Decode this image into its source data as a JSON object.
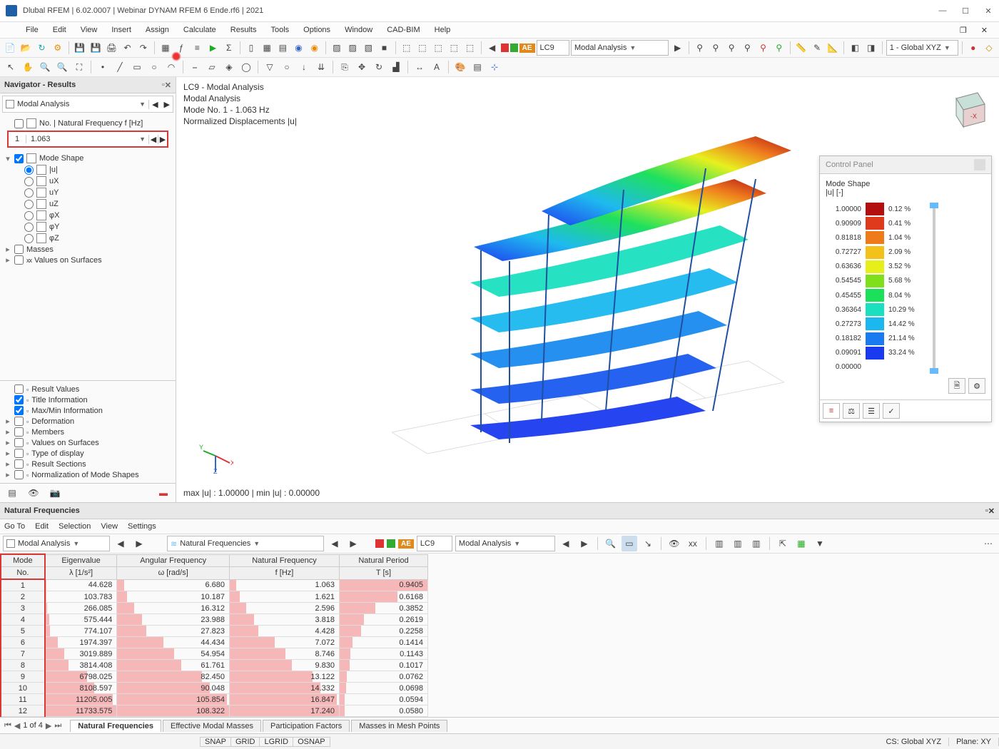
{
  "title": "Dlubal RFEM | 6.02.0007 | Webinar DYNAM RFEM 6 Ende.rf6 | 2021",
  "menus": [
    "File",
    "Edit",
    "View",
    "Insert",
    "Assign",
    "Calculate",
    "Results",
    "Tools",
    "Options",
    "Window",
    "CAD-BIM",
    "Help"
  ],
  "toolbar1": {
    "lc_label": "LC9",
    "lc_name": "Modal Analysis",
    "coord": "1 - Global XYZ"
  },
  "navigator": {
    "title": "Navigator - Results",
    "analysis": "Modal Analysis",
    "freq_header": "No. | Natural Frequency f [Hz]",
    "sel_no": "1",
    "sel_val": "1.063",
    "mode_shape": "Mode Shape",
    "components": [
      "|u|",
      "uX",
      "uY",
      "uZ",
      "φX",
      "φY",
      "φZ"
    ],
    "masses": "Masses",
    "vos": "Values on Surfaces",
    "opts": [
      "Result Values",
      "Title Information",
      "Max/Min Information",
      "Deformation",
      "Members",
      "Values on Surfaces",
      "Type of display",
      "Result Sections",
      "Normalization of Mode Shapes"
    ]
  },
  "viewport": {
    "l1": "LC9 - Modal Analysis",
    "l2": "Modal Analysis",
    "l3": "Mode No. 1 - 1.063 Hz",
    "l4": "Normalized Displacements |u|",
    "minmax": "max |u| : 1.00000 | min |u| : 0.00000"
  },
  "panel": {
    "title": "Control Panel",
    "sub1": "Mode Shape",
    "sub2": "|u| [-]",
    "legend": [
      {
        "v": "1.00000",
        "c": "#b30f0f",
        "p": "0.12 %"
      },
      {
        "v": "0.90909",
        "c": "#e03a1c",
        "p": "0.41 %"
      },
      {
        "v": "0.81818",
        "c": "#ef7a1a",
        "p": "1.04 %"
      },
      {
        "v": "0.72727",
        "c": "#f4c11a",
        "p": "2.09 %"
      },
      {
        "v": "0.63636",
        "c": "#e7ef1a",
        "p": "3.52 %"
      },
      {
        "v": "0.54545",
        "c": "#7ee01a",
        "p": "5.68 %"
      },
      {
        "v": "0.45455",
        "c": "#1ae05a",
        "p": "8.04 %"
      },
      {
        "v": "0.36364",
        "c": "#1ae0c0",
        "p": "10.29 %"
      },
      {
        "v": "0.27273",
        "c": "#1ab8ef",
        "p": "14.42 %"
      },
      {
        "v": "0.18182",
        "c": "#1a7aef",
        "p": "21.14 %"
      },
      {
        "v": "0.09091",
        "c": "#1a3aef",
        "p": "33.24 %"
      },
      {
        "v": "0.00000",
        "c": "",
        "p": ""
      }
    ]
  },
  "table": {
    "title": "Natural Frequencies",
    "menus": [
      "Go To",
      "Edit",
      "Selection",
      "View",
      "Settings"
    ],
    "analysis": "Modal Analysis",
    "view": "Natural Frequencies",
    "lc": "LC9",
    "lc_name": "Modal Analysis",
    "cols": [
      {
        "h1": "Mode",
        "h2": "No."
      },
      {
        "h1": "Eigenvalue",
        "h2": "λ [1/s²]"
      },
      {
        "h1": "Angular Frequency",
        "h2": "ω [rad/s]"
      },
      {
        "h1": "Natural Frequency",
        "h2": "f [Hz]"
      },
      {
        "h1": "Natural Period",
        "h2": "T [s]"
      }
    ],
    "rows": [
      {
        "n": 1,
        "e": "44.628",
        "w": "6.680",
        "f": "1.063",
        "t": "0.9405",
        "be": 0.4,
        "bw": 6,
        "bf": 6,
        "bt": 100
      },
      {
        "n": 2,
        "e": "103.783",
        "w": "10.187",
        "f": "1.621",
        "t": "0.6168",
        "be": 0.9,
        "bw": 9,
        "bf": 9,
        "bt": 66
      },
      {
        "n": 3,
        "e": "266.085",
        "w": "16.312",
        "f": "2.596",
        "t": "0.3852",
        "be": 2.3,
        "bw": 15,
        "bf": 15,
        "bt": 41
      },
      {
        "n": 4,
        "e": "575.444",
        "w": "23.988",
        "f": "3.818",
        "t": "0.2619",
        "be": 4.9,
        "bw": 22,
        "bf": 22,
        "bt": 28
      },
      {
        "n": 5,
        "e": "774.107",
        "w": "27.823",
        "f": "4.428",
        "t": "0.2258",
        "be": 6.6,
        "bw": 26,
        "bf": 26,
        "bt": 24
      },
      {
        "n": 6,
        "e": "1974.397",
        "w": "44.434",
        "f": "7.072",
        "t": "0.1414",
        "be": 17,
        "bw": 41,
        "bf": 41,
        "bt": 15
      },
      {
        "n": 7,
        "e": "3019.889",
        "w": "54.954",
        "f": "8.746",
        "t": "0.1143",
        "be": 26,
        "bw": 51,
        "bf": 51,
        "bt": 12
      },
      {
        "n": 8,
        "e": "3814.408",
        "w": "61.761",
        "f": "9.830",
        "t": "0.1017",
        "be": 32,
        "bw": 57,
        "bf": 57,
        "bt": 11
      },
      {
        "n": 9,
        "e": "6798.025",
        "w": "82.450",
        "f": "13.122",
        "t": "0.0762",
        "be": 58,
        "bw": 76,
        "bf": 76,
        "bt": 8
      },
      {
        "n": 10,
        "e": "8108.597",
        "w": "90.048",
        "f": "14.332",
        "t": "0.0698",
        "be": 69,
        "bw": 83,
        "bf": 83,
        "bt": 7
      },
      {
        "n": 11,
        "e": "11205.005",
        "w": "105.854",
        "f": "16.847",
        "t": "0.0594",
        "be": 95,
        "bw": 98,
        "bf": 98,
        "bt": 6
      },
      {
        "n": 12,
        "e": "11733.575",
        "w": "108.322",
        "f": "17.240",
        "t": "0.0580",
        "be": 100,
        "bw": 100,
        "bf": 100,
        "bt": 6
      }
    ],
    "page": "1 of 4",
    "tabs": [
      "Natural Frequencies",
      "Effective Modal Masses",
      "Participation Factors",
      "Masses in Mesh Points"
    ]
  },
  "status": {
    "snap": [
      "SNAP",
      "GRID",
      "LGRID",
      "OSNAP"
    ],
    "cs": "CS: Global XYZ",
    "plane": "Plane: XY"
  }
}
